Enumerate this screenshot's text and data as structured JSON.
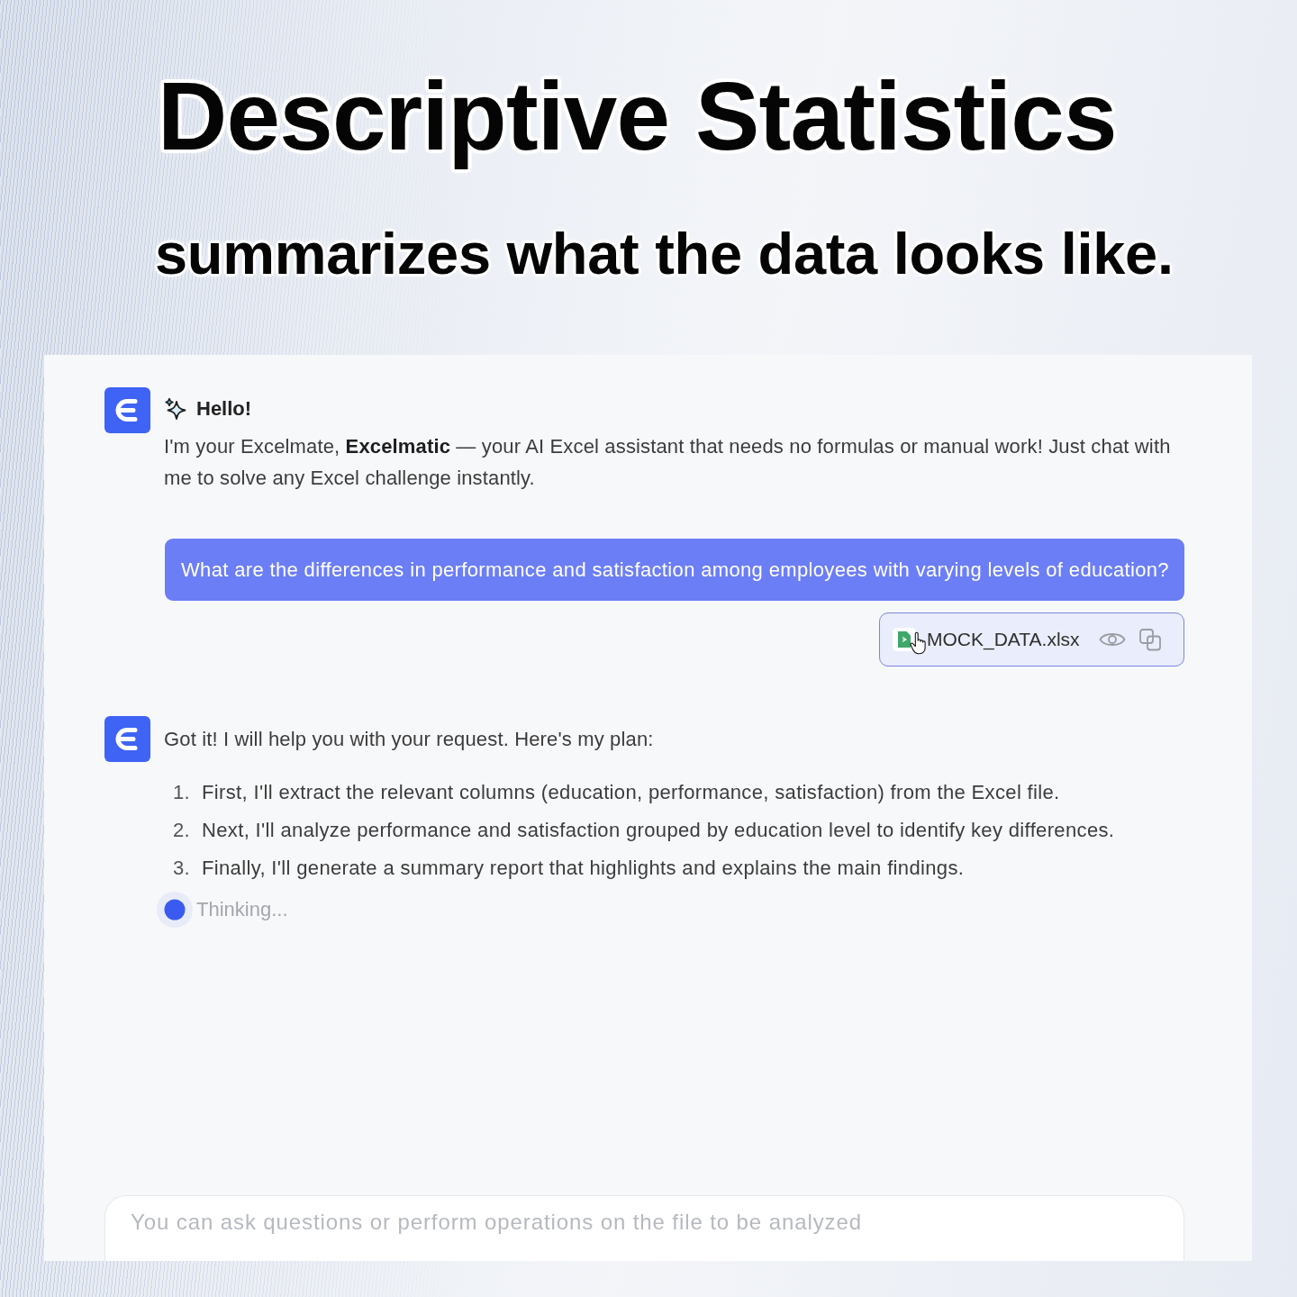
{
  "headline": {
    "title": "Descriptive Statistics",
    "subtitle": "summarizes what the data looks like."
  },
  "chat": {
    "messages": [
      {
        "kind": "assistant",
        "greeting": "Hello!",
        "text": "I'm your Excelmate, **Excelmatic** — your AI Excel assistant that needs no formulas or manual work! Just chat with me to solve any Excel challenge instantly."
      },
      {
        "kind": "user",
        "text": "What are the differences in performance and satisfaction among employees with varying levels of education?",
        "attachment": {
          "file_name": "MOCK_DATA.xlsx"
        }
      },
      {
        "kind": "assistant",
        "text": "Got it! I will help you with your request. Here's my plan:",
        "steps": [
          {
            "number": "1.",
            "text": "First, I'll extract the relevant columns (education, performance, satisfaction) from the Excel file."
          },
          {
            "number": "2.",
            "text": "Next, I'll analyze performance and satisfaction grouped by education level to identify key differences."
          },
          {
            "number": "3.",
            "text": "Finally, I'll generate a summary report that highlights and explains the main findings."
          }
        ],
        "status": "Thinking..."
      }
    ],
    "input": {
      "placeholder": "You can ask questions or perform operations on the file to be analyzed"
    }
  }
}
